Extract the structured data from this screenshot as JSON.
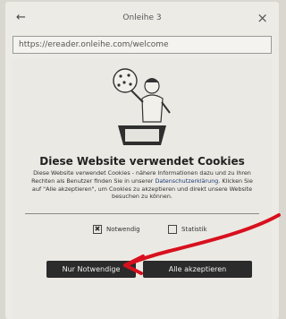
{
  "window": {
    "title": "Onleihe 3",
    "back_icon": "arrow-left-icon",
    "close_icon": "close-icon"
  },
  "address_bar": {
    "url": "https://ereader.onleihe.com/welcome"
  },
  "cookie_dialog": {
    "heading": "Diese Website verwendet Cookies",
    "body_part1": "Diese Website verwendet Cookies - nähere Informationen dazu und zu Ihren Rechten als Benutzer finden Sie in unserer ",
    "body_link": "Datenschutzerklärung",
    "body_part2": ". Klicken Sie auf \"Alle akzeptieren\", um Cookies zu akzeptieren und direkt unsere Website besuchen zu können.",
    "checkbox_necessary": {
      "label": "Notwendig",
      "checked": true
    },
    "checkbox_statistics": {
      "label": "Statistik",
      "checked": false
    },
    "button_necessary_only": "Nur Notwendige",
    "button_accept_all": "Alle akzeptieren"
  },
  "colors": {
    "screen_bg": "#ecebe6",
    "button_bg": "#2b2b2b",
    "annotation_arrow": "#d8101e"
  }
}
